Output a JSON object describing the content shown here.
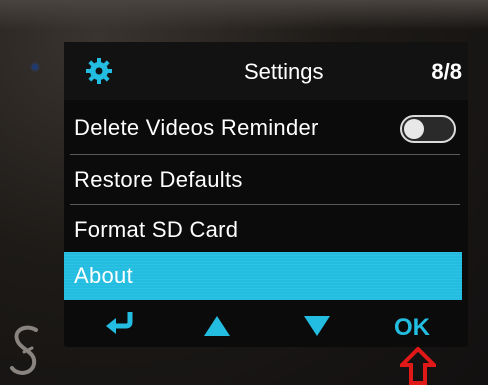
{
  "header": {
    "title": "Settings",
    "page_indicator": "8/8",
    "icon": "gear-icon"
  },
  "menu": {
    "items": [
      {
        "label": "Delete Videos Reminder",
        "control": "toggle",
        "toggle_on": false
      },
      {
        "label": "Restore Defaults"
      },
      {
        "label": "Format SD Card"
      },
      {
        "label": "About",
        "selected": true
      }
    ]
  },
  "footer": {
    "back_icon": "return-arrow-icon",
    "up_icon": "triangle-up-icon",
    "down_icon": "triangle-down-icon",
    "ok_label": "OK"
  },
  "colors": {
    "accent": "#22bde0",
    "screen_bg": "#0b0b0b",
    "text": "#ffffff",
    "indicator_arrow": "#e01818"
  }
}
